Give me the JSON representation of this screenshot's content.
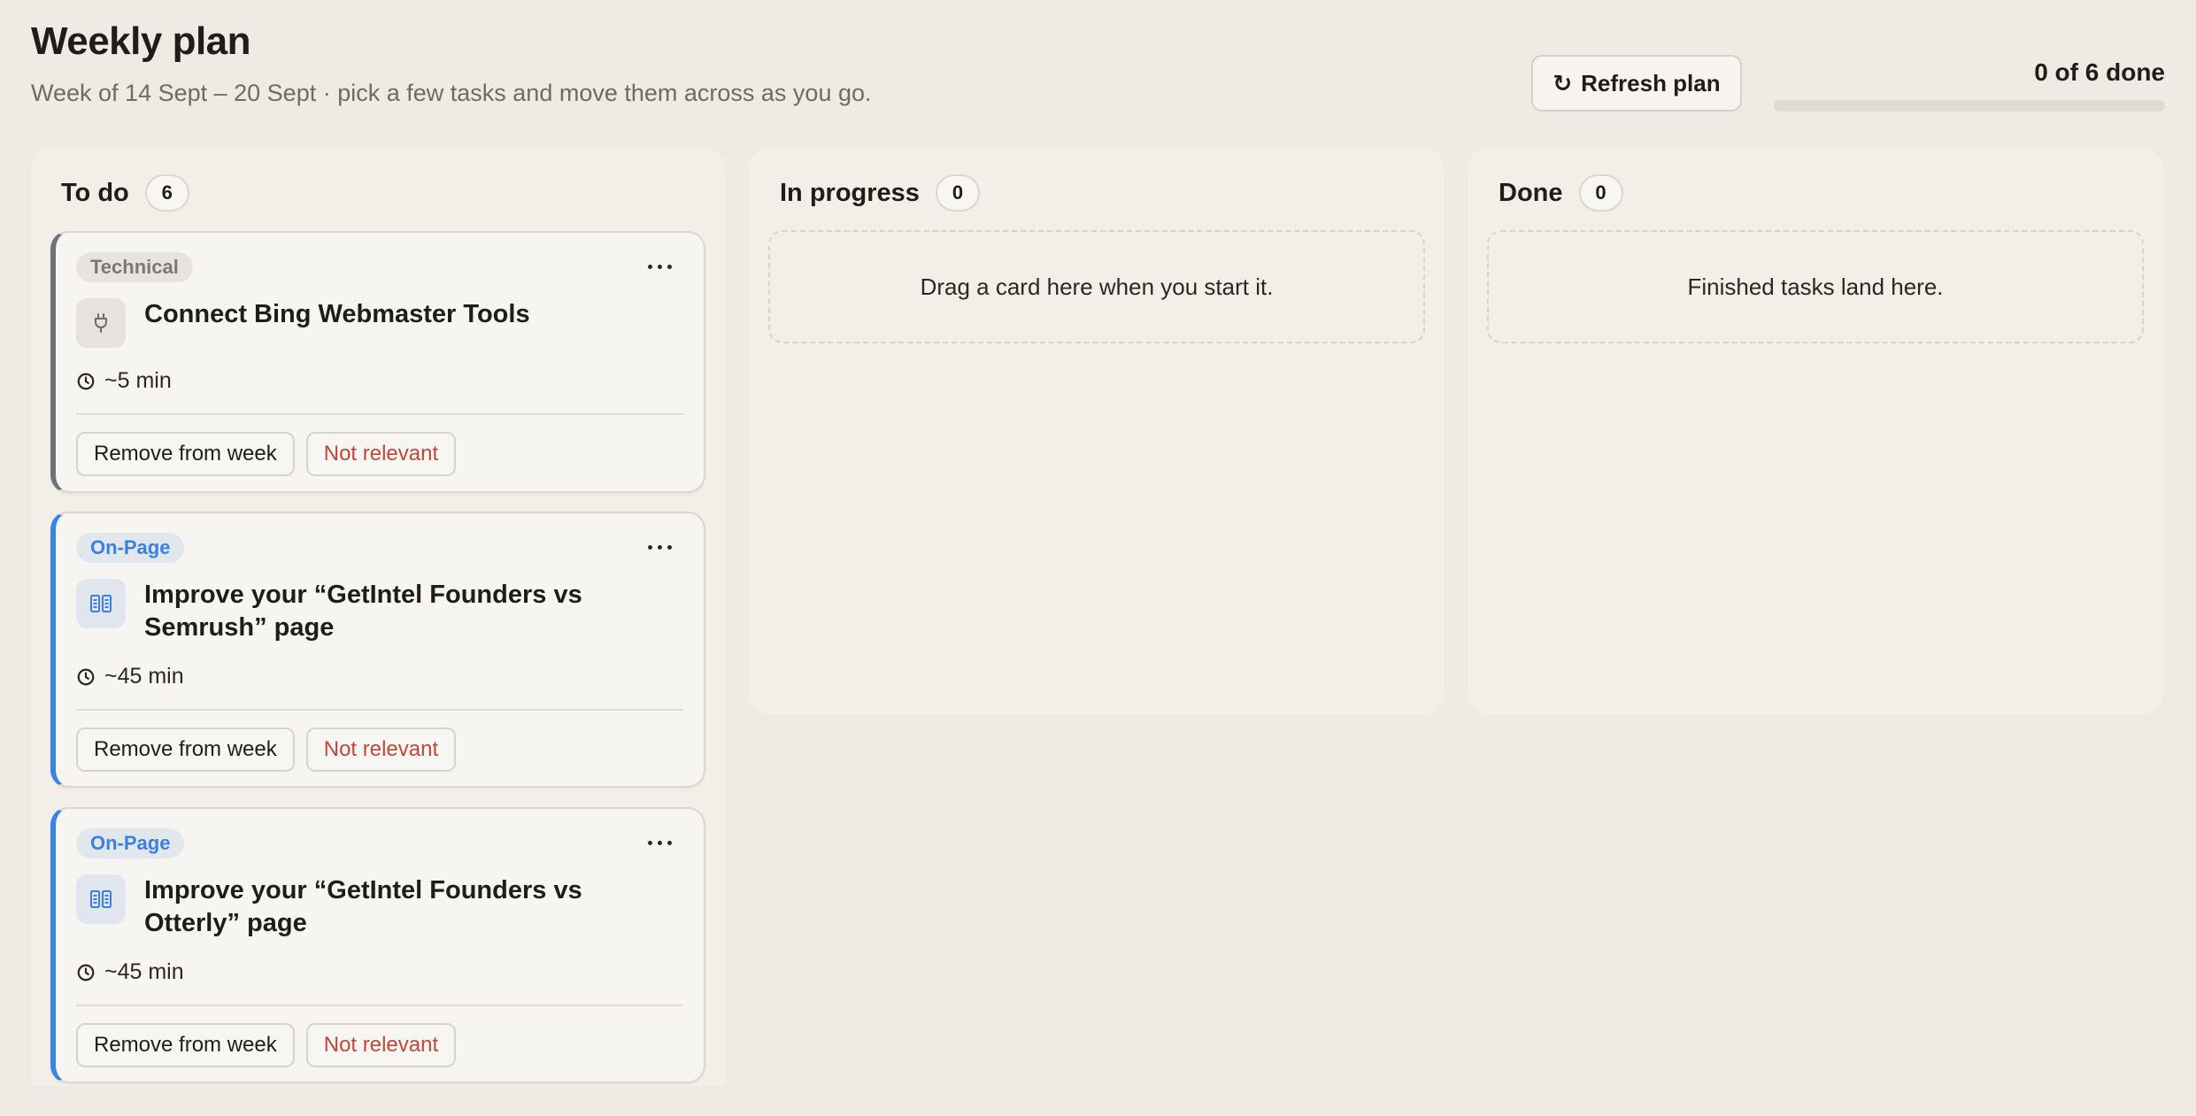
{
  "header": {
    "title": "Weekly plan",
    "subtitle": "Week of 14 Sept – 20 Sept · pick a few tasks and move them across as you go.",
    "refresh_label": "Refresh plan",
    "refresh_icon": "refresh-icon",
    "progress_label": "0 of 6 done",
    "progress_done": 0,
    "progress_total": 6
  },
  "columns": {
    "todo": {
      "title": "To do",
      "count": "6"
    },
    "in_progress": {
      "title": "In progress",
      "count": "0",
      "empty_text": "Drag a card here when you start it."
    },
    "done": {
      "title": "Done",
      "count": "0",
      "empty_text": "Finished tasks land here."
    }
  },
  "cards": [
    {
      "tag": "Technical",
      "icon": "plug-icon",
      "title": "Connect Bing Webmaster Tools",
      "duration": "~5 min",
      "remove_label": "Remove from week",
      "not_relevant_label": "Not relevant"
    },
    {
      "tag": "On-Page",
      "icon": "page-icon",
      "title": "Improve your “GetIntel Founders vs Semrush” page",
      "duration": "~45 min",
      "remove_label": "Remove from week",
      "not_relevant_label": "Not relevant"
    },
    {
      "tag": "On-Page",
      "icon": "page-icon",
      "title": "Improve your “GetIntel Founders vs Otterly” page",
      "duration": "~45 min",
      "remove_label": "Remove from week",
      "not_relevant_label": "Not relevant"
    }
  ],
  "colors": {
    "technical_accent": "#6d7178",
    "onpage_accent": "#3b82e6",
    "not_relevant_text": "#c0473a"
  }
}
